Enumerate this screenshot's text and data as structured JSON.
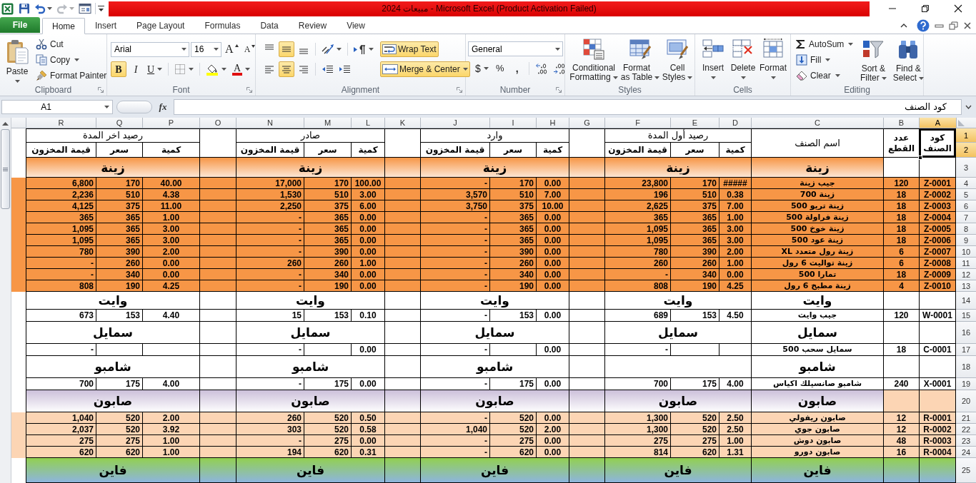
{
  "title_bar": {
    "title": "مبيعات 2024 - Microsoft Excel (Product Activation Failed)"
  },
  "tabs": [
    {
      "label": "File",
      "kind": "file",
      "selected": false
    },
    {
      "label": "Home",
      "kind": "tab",
      "selected": true
    },
    {
      "label": "Insert",
      "kind": "tab",
      "selected": false
    },
    {
      "label": "Page Layout",
      "kind": "tab",
      "selected": false
    },
    {
      "label": "Formulas",
      "kind": "tab",
      "selected": false
    },
    {
      "label": "Data",
      "kind": "tab",
      "selected": false
    },
    {
      "label": "Review",
      "kind": "tab",
      "selected": false
    },
    {
      "label": "View",
      "kind": "tab",
      "selected": false
    }
  ],
  "ribbon": {
    "groups": [
      {
        "label": "Clipboard",
        "launcher": true,
        "items": [
          {
            "kind": "large",
            "label": "Paste",
            "dropdown": true
          },
          {
            "kind": "small",
            "label": "Cut"
          },
          {
            "kind": "small",
            "label": "Copy",
            "dropdown": true
          },
          {
            "kind": "small",
            "label": "Format Painter"
          }
        ]
      },
      {
        "label": "Font",
        "launcher": true,
        "items": [
          {
            "kind": "combo",
            "value": "Arial"
          },
          {
            "kind": "combo",
            "value": "16"
          },
          {
            "kind": "tool",
            "label": "A"
          },
          {
            "kind": "tool",
            "label": "A"
          },
          {
            "kind": "toggle",
            "label": "B",
            "on": true
          },
          {
            "kind": "toggle",
            "label": "I",
            "on": false
          },
          {
            "kind": "toggle",
            "label": "U",
            "on": false,
            "dropdown": true
          },
          {
            "kind": "tool",
            "dropdown": true
          },
          {
            "kind": "tool",
            "dropdown": true
          },
          {
            "kind": "tool",
            "label": "A",
            "dropdown": true
          }
        ]
      },
      {
        "label": "Alignment",
        "launcher": true,
        "items": [
          {
            "kind": "toggle",
            "on": false
          },
          {
            "kind": "toggle",
            "on": true
          },
          {
            "kind": "toggle",
            "on": false
          },
          {
            "kind": "tool",
            "dropdown": true
          },
          {
            "kind": "tool",
            "dropdown": true
          },
          {
            "kind": "toggle",
            "label": "Wrap Text",
            "on": true
          },
          {
            "kind": "toggle",
            "on": false
          },
          {
            "kind": "toggle",
            "on": true
          },
          {
            "kind": "toggle",
            "on": false
          },
          {
            "kind": "tool"
          },
          {
            "kind": "tool"
          },
          {
            "kind": "toggle",
            "label": "Merge & Center",
            "on": true,
            "dropdown": true
          }
        ]
      },
      {
        "label": "Number",
        "launcher": true,
        "items": [
          {
            "kind": "combo",
            "value": "General"
          },
          {
            "kind": "tool",
            "label": "$",
            "dropdown": true
          },
          {
            "kind": "tool",
            "label": "%"
          },
          {
            "kind": "tool",
            "label": ","
          },
          {
            "kind": "tool"
          },
          {
            "kind": "tool"
          }
        ]
      },
      {
        "label": "Styles",
        "items": [
          {
            "kind": "large",
            "label": "Conditional Formatting",
            "dropdown": true
          },
          {
            "kind": "large",
            "label": "Format as Table",
            "dropdown": true
          },
          {
            "kind": "large",
            "label": "Cell Styles",
            "dropdown": true
          }
        ]
      },
      {
        "label": "Cells",
        "items": [
          {
            "kind": "large",
            "label": "Insert",
            "dropdown": true
          },
          {
            "kind": "large",
            "label": "Delete",
            "dropdown": true
          },
          {
            "kind": "large",
            "label": "Format",
            "dropdown": true
          }
        ]
      },
      {
        "label": "Editing",
        "items": [
          {
            "kind": "small",
            "label": "AutoSum",
            "dropdown": true
          },
          {
            "kind": "small",
            "label": "Fill",
            "dropdown": true
          },
          {
            "kind": "small",
            "label": "Clear",
            "dropdown": true
          },
          {
            "kind": "large",
            "label": "Sort & Filter",
            "dropdown": true
          },
          {
            "kind": "large",
            "label": "Find & Select",
            "dropdown": true
          }
        ]
      }
    ]
  },
  "formula_bar": {
    "name_box": "A1",
    "function_label": "fx",
    "formula": "كود الصنف"
  },
  "sheet": {
    "columns": [
      {
        "label": "R",
        "selected": false
      },
      {
        "label": "Q",
        "selected": false
      },
      {
        "label": "P",
        "selected": false
      },
      {
        "label": "O",
        "selected": false
      },
      {
        "label": "N",
        "selected": false
      },
      {
        "label": "M",
        "selected": false
      },
      {
        "label": "L",
        "selected": false
      },
      {
        "label": "K",
        "selected": false
      },
      {
        "label": "J",
        "selected": false
      },
      {
        "label": "I",
        "selected": false
      },
      {
        "label": "H",
        "selected": false
      },
      {
        "label": "G",
        "selected": false
      },
      {
        "label": "F",
        "selected": false
      },
      {
        "label": "E",
        "selected": false
      },
      {
        "label": "D",
        "selected": false
      },
      {
        "label": "C",
        "selected": false
      },
      {
        "label": "B",
        "selected": false
      },
      {
        "label": "A",
        "selected": true
      }
    ],
    "row_headers": [
      {
        "label": "1",
        "selected": true
      },
      {
        "label": "2",
        "selected": true
      },
      {
        "label": "3",
        "selected": false
      },
      {
        "label": "4",
        "selected": false
      },
      {
        "label": "5",
        "selected": false
      },
      {
        "label": "6",
        "selected": false
      },
      {
        "label": "7",
        "selected": false
      },
      {
        "label": "8",
        "selected": false
      },
      {
        "label": "9",
        "selected": false
      },
      {
        "label": "10",
        "selected": false
      },
      {
        "label": "11",
        "selected": false
      },
      {
        "label": "12",
        "selected": false
      },
      {
        "label": "13",
        "selected": false
      },
      {
        "label": "14",
        "selected": false
      },
      {
        "label": "15",
        "selected": false
      },
      {
        "label": "16",
        "selected": false
      },
      {
        "label": "17",
        "selected": false
      },
      {
        "label": "18",
        "selected": false
      },
      {
        "label": "19",
        "selected": false
      },
      {
        "label": "20",
        "selected": false
      },
      {
        "label": "21",
        "selected": false
      },
      {
        "label": "22",
        "selected": false
      },
      {
        "label": "23",
        "selected": false
      },
      {
        "label": "24",
        "selected": false
      },
      {
        "label": "25",
        "selected": false
      }
    ],
    "header": {
      "code": {
        "text": "كود الصنف",
        "selected": true
      },
      "pieces": "عدد القطع",
      "name": "اسم الصنف",
      "opening": {
        "title": "رصيد أول المدة",
        "qty": "كمية",
        "price": "سعر",
        "value": "قيمة المخزون"
      },
      "incoming": {
        "title": "وارد",
        "qty": "كمية",
        "price": "سعر",
        "value": "قيمة المخزون"
      },
      "outgoing": {
        "title": "صادر",
        "qty": "كمية",
        "price": "سعر",
        "value": "قيمة المخزون"
      },
      "closing": {
        "title": "رصيد اخر المدة",
        "qty": "كمية",
        "price": "سعر",
        "value": "قيمة المخزون"
      }
    },
    "groups": [
      {
        "name": "زينة",
        "gradient": [
          {
            "color": "#f79646"
          },
          {
            "color": "#fde9d9"
          }
        ],
        "code_cells": {
          "color": "#ffffff"
        },
        "opening": "زينة",
        "incoming": "زينة",
        "outgoing": "زينة",
        "closing": "زينة",
        "items": [
          {
            "code": "Z-0001",
            "pieces": "120",
            "name": "جيب زينة",
            "color": "#f79646",
            "opening": {
              "qty": "#####",
              "price": "170",
              "value": "23,800"
            },
            "incoming": {
              "qty": "0.00",
              "price": "170",
              "value": "-"
            },
            "outgoing": {
              "qty": "100.00",
              "price": "170",
              "value": "17,000"
            },
            "closing": {
              "qty": "40.00",
              "price": "170",
              "value": "6,800"
            }
          },
          {
            "code": "Z-0002",
            "pieces": "18",
            "name": "زينة 700",
            "color": "#f79646",
            "opening": {
              "qty": "0.38",
              "price": "510",
              "value": "196"
            },
            "incoming": {
              "qty": "7.00",
              "price": "510",
              "value": "3,570"
            },
            "outgoing": {
              "qty": "3.00",
              "price": "510",
              "value": "1,530"
            },
            "closing": {
              "qty": "4.38",
              "price": "510",
              "value": "2,236"
            }
          },
          {
            "code": "Z-0003",
            "pieces": "18",
            "name": "زينة تريو 500",
            "color": "#f79646",
            "opening": {
              "qty": "7.00",
              "price": "375",
              "value": "2,625"
            },
            "incoming": {
              "qty": "10.00",
              "price": "375",
              "value": "3,750"
            },
            "outgoing": {
              "qty": "6.00",
              "price": "375",
              "value": "2,250"
            },
            "closing": {
              "qty": "11.00",
              "price": "375",
              "value": "4,125"
            }
          },
          {
            "code": "Z-0004",
            "pieces": "18",
            "name": "زينة فراولة 500",
            "color": "#f79646",
            "opening": {
              "qty": "1.00",
              "price": "365",
              "value": "365"
            },
            "incoming": {
              "qty": "0.00",
              "price": "365",
              "value": "-"
            },
            "outgoing": {
              "qty": "0.00",
              "price": "365",
              "value": "-"
            },
            "closing": {
              "qty": "1.00",
              "price": "365",
              "value": "365"
            }
          },
          {
            "code": "Z-0005",
            "pieces": "18",
            "name": "زينة خوخ 500",
            "color": "#f79646",
            "opening": {
              "qty": "3.00",
              "price": "365",
              "value": "1,095"
            },
            "incoming": {
              "qty": "0.00",
              "price": "365",
              "value": "-"
            },
            "outgoing": {
              "qty": "0.00",
              "price": "365",
              "value": "-"
            },
            "closing": {
              "qty": "3.00",
              "price": "365",
              "value": "1,095"
            }
          },
          {
            "code": "Z-0006",
            "pieces": "18",
            "name": "زينة عود 500",
            "color": "#f79646",
            "opening": {
              "qty": "3.00",
              "price": "365",
              "value": "1,095"
            },
            "incoming": {
              "qty": "0.00",
              "price": "365",
              "value": "-"
            },
            "outgoing": {
              "qty": "0.00",
              "price": "365",
              "value": "-"
            },
            "closing": {
              "qty": "3.00",
              "price": "365",
              "value": "1,095"
            }
          },
          {
            "code": "Z-0007",
            "pieces": "6",
            "name": "زينة رول متعدد XL",
            "color": "#f79646",
            "opening": {
              "qty": "2.00",
              "price": "390",
              "value": "780"
            },
            "incoming": {
              "qty": "0.00",
              "price": "390",
              "value": "-"
            },
            "outgoing": {
              "qty": "0.00",
              "price": "390",
              "value": "-"
            },
            "closing": {
              "qty": "2.00",
              "price": "390",
              "value": "780"
            }
          },
          {
            "code": "Z-0008",
            "pieces": "6",
            "name": "زينة تواليت 6 رول",
            "color": "#f79646",
            "opening": {
              "qty": "1.00",
              "price": "260",
              "value": "260"
            },
            "incoming": {
              "qty": "0.00",
              "price": "260",
              "value": "-"
            },
            "outgoing": {
              "qty": "1.00",
              "price": "260",
              "value": "260"
            },
            "closing": {
              "qty": "0.00",
              "price": "260",
              "value": "-"
            }
          },
          {
            "code": "Z-0009",
            "pieces": "18",
            "name": "تمارا 500",
            "color": "#f79646",
            "opening": {
              "qty": "0.00",
              "price": "340",
              "value": "-"
            },
            "incoming": {
              "qty": "0.00",
              "price": "340",
              "value": "-"
            },
            "outgoing": {
              "qty": "0.00",
              "price": "340",
              "value": "-"
            },
            "closing": {
              "qty": "0.00",
              "price": "340",
              "value": "-"
            }
          },
          {
            "code": "Z-0010",
            "pieces": "4",
            "name": "زينة مطبخ 6 رول",
            "color": "#f79646",
            "opening": {
              "qty": "4.25",
              "price": "190",
              "value": "808"
            },
            "incoming": {
              "qty": "0.00",
              "price": "190",
              "value": "-"
            },
            "outgoing": {
              "qty": "0.00",
              "price": "190",
              "value": "-"
            },
            "closing": {
              "qty": "4.25",
              "price": "190",
              "value": "808"
            }
          }
        ]
      },
      {
        "name": "وايت",
        "color": "#ffffff",
        "opening": "وايت",
        "incoming": "وايت",
        "outgoing": "وايت",
        "closing": "وايت",
        "items": [
          {
            "code": "W-0001",
            "pieces": "120",
            "name": "جيب وايت",
            "color": "#ffffff",
            "opening": {
              "qty": "4.50",
              "price": "153",
              "value": "689"
            },
            "incoming": {
              "qty": "0.00",
              "price": "153",
              "value": "-"
            },
            "outgoing": {
              "qty": "0.10",
              "price": "153",
              "value": "15"
            },
            "closing": {
              "qty": "4.40",
              "price": "153",
              "value": "673"
            }
          }
        ]
      },
      {
        "name": "سمايل",
        "color": "#ffffff",
        "opening": "سمايل",
        "incoming": "سمايل",
        "outgoing": "سمايل",
        "closing": "سمايل",
        "items": [
          {
            "code": "C-0001",
            "pieces": "18",
            "name": "سمايل سحب 500",
            "color": "#ffffff",
            "opening": {
              "value": "-"
            },
            "incoming": {
              "qty": "0.00",
              "value": "-"
            },
            "outgoing": {
              "qty": "0.00",
              "value": "-"
            },
            "closing": {
              "value": "-"
            }
          }
        ]
      },
      {
        "name": "شامبو",
        "color": "#ffffff",
        "incoming": "شامبو",
        "outgoing": "شامبو",
        "closing": "شامبو",
        "items": [
          {
            "code": "X-0001",
            "pieces": "240",
            "name": "شامبو صانسيلك اكياس",
            "color": "#ffffff",
            "opening": {
              "qty": "4.00",
              "price": "175",
              "value": "700"
            },
            "incoming": {
              "qty": "0.00",
              "price": "175",
              "value": "-"
            },
            "outgoing": {
              "qty": "0.00",
              "price": "175",
              "value": "-"
            },
            "closing": {
              "qty": "4.00",
              "price": "175",
              "value": "700"
            }
          }
        ]
      },
      {
        "name": "صابون",
        "gradient": [
          {
            "color": "#ccc0da"
          },
          {
            "color": "#ffffff"
          }
        ],
        "code_cells": {
          "color": "#fcd5b4"
        },
        "opening": "صابون",
        "incoming": "صابون",
        "outgoing": "صابون",
        "closing": "صابون",
        "items": [
          {
            "code": "R-0001",
            "pieces": "12",
            "name": "صابون ريفولي",
            "color": "#fcd5b4",
            "opening": {
              "qty": "2.50",
              "price": "520",
              "value": "1,300"
            },
            "incoming": {
              "qty": "0.00",
              "price": "520",
              "value": "-"
            },
            "outgoing": {
              "qty": "0.50",
              "price": "520",
              "value": "260"
            },
            "closing": {
              "qty": "2.00",
              "price": "520",
              "value": "1,040"
            }
          },
          {
            "code": "R-0002",
            "pieces": "12",
            "name": "صابون جوي",
            "color": "#fcd5b4",
            "opening": {
              "qty": "2.50",
              "price": "520",
              "value": "1,300"
            },
            "incoming": {
              "qty": "2.00",
              "price": "520",
              "value": "1,040"
            },
            "outgoing": {
              "qty": "0.58",
              "price": "520",
              "value": "303"
            },
            "closing": {
              "qty": "3.92",
              "price": "520",
              "value": "2,037"
            }
          },
          {
            "code": "R-0003",
            "pieces": "48",
            "name": "صابون دوش",
            "color": "#fcd5b4",
            "opening": {
              "qty": "1.00",
              "price": "275",
              "value": "275"
            },
            "incoming": {
              "qty": "0.00",
              "price": "275",
              "value": "-"
            },
            "outgoing": {
              "qty": "0.00",
              "price": "275",
              "value": "-"
            },
            "closing": {
              "qty": "1.00",
              "price": "275",
              "value": "275"
            }
          },
          {
            "code": "R-0004",
            "pieces": "16",
            "name": "صابون دورو",
            "color": "#fcd5b4",
            "opening": {
              "qty": "1.31",
              "price": "620",
              "value": "814"
            },
            "incoming": {
              "qty": "0.00",
              "price": "620",
              "value": "-"
            },
            "outgoing": {
              "qty": "0.31",
              "price": "620",
              "value": "194"
            },
            "closing": {
              "qty": "1.00",
              "price": "620",
              "value": "620"
            }
          }
        ]
      },
      {
        "name": "فاين",
        "gradient": [
          {
            "color": "#92d050"
          },
          {
            "color": "#8db4e2"
          }
        ],
        "opening": "فاين",
        "incoming": "فاين",
        "outgoing": "فاين",
        "closing": "فاين"
      }
    ]
  }
}
